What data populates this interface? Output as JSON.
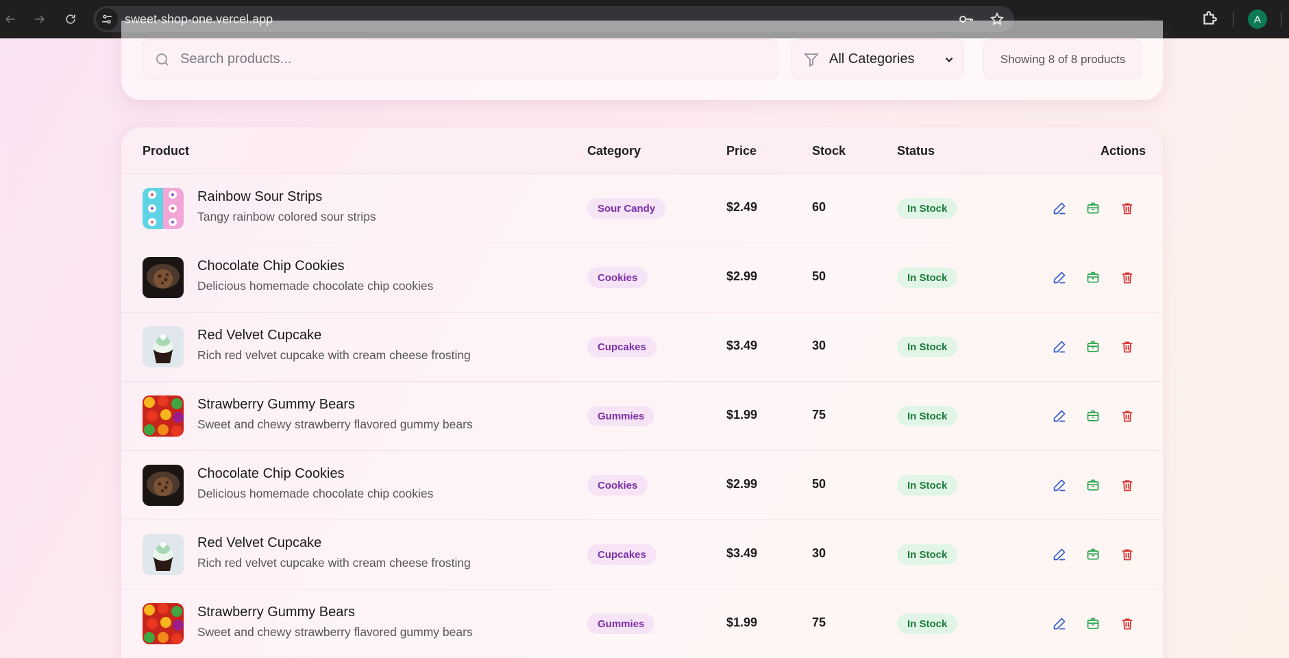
{
  "browser": {
    "url": "sweet-shop-one.vercel.app",
    "profile_initial": "A"
  },
  "filters": {
    "search_placeholder": "Search products...",
    "category_selected": "All Categories",
    "result_count": "Showing 8 of 8 products"
  },
  "table": {
    "headers": {
      "product": "Product",
      "category": "Category",
      "price": "Price",
      "stock": "Stock",
      "status": "Status",
      "actions": "Actions"
    },
    "rows": [
      {
        "name": "Rainbow Sour Strips",
        "description": "Tangy rainbow colored sour strips",
        "category": "Sour Candy",
        "price": "$2.49",
        "stock": "60",
        "status": "In Stock",
        "image": "rainbow-candy-thumbnail"
      },
      {
        "name": "Chocolate Chip Cookies",
        "description": "Delicious homemade chocolate chip cookies",
        "category": "Cookies",
        "price": "$2.99",
        "stock": "50",
        "status": "In Stock",
        "image": "cookies-thumbnail"
      },
      {
        "name": "Red Velvet Cupcake",
        "description": "Rich red velvet cupcake with cream cheese frosting",
        "category": "Cupcakes",
        "price": "$3.49",
        "stock": "30",
        "status": "In Stock",
        "image": "cupcake-thumbnail"
      },
      {
        "name": "Strawberry Gummy Bears",
        "description": "Sweet and chewy strawberry flavored gummy bears",
        "category": "Gummies",
        "price": "$1.99",
        "stock": "75",
        "status": "In Stock",
        "image": "gummy-bears-thumbnail"
      },
      {
        "name": "Chocolate Chip Cookies",
        "description": "Delicious homemade chocolate chip cookies",
        "category": "Cookies",
        "price": "$2.99",
        "stock": "50",
        "status": "In Stock",
        "image": "cookies-thumbnail"
      },
      {
        "name": "Red Velvet Cupcake",
        "description": "Rich red velvet cupcake with cream cheese frosting",
        "category": "Cupcakes",
        "price": "$3.49",
        "stock": "30",
        "status": "In Stock",
        "image": "cupcake-thumbnail"
      },
      {
        "name": "Strawberry Gummy Bears",
        "description": "Sweet and chewy strawberry flavored gummy bears",
        "category": "Gummies",
        "price": "$1.99",
        "stock": "75",
        "status": "In Stock",
        "image": "gummy-bears-thumbnail"
      }
    ]
  },
  "colors": {
    "category_badge_bg": "#f6e4f6",
    "category_badge_text": "#7a2fa8",
    "status_badge_bg": "#e1f5e6",
    "status_badge_text": "#1d7a3a",
    "edit_icon": "#2f5bd1",
    "restock_icon": "#22a447",
    "delete_icon": "#d93232"
  },
  "icons": {
    "edit": "pencil-icon",
    "restock": "package-icon",
    "delete": "trash-icon"
  }
}
